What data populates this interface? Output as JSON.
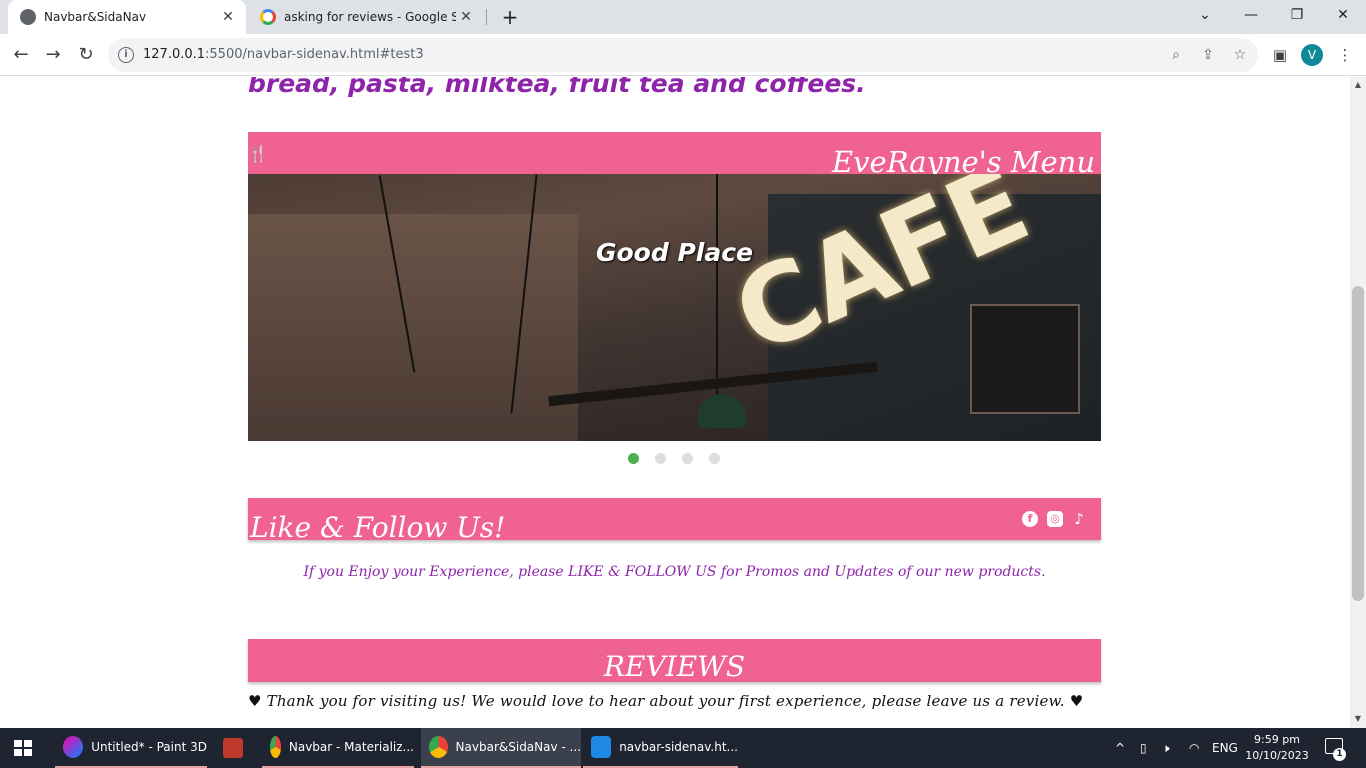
{
  "browser": {
    "tabs": [
      {
        "title": "Navbar&SidaNav",
        "active": true
      },
      {
        "title": "asking for reviews - Google Sear",
        "active": false
      }
    ],
    "new_tab_label": "+",
    "url_host": "127.0.0.1",
    "url_rest": ":5500/navbar-sidenav.html#test3",
    "profile_initial": "V"
  },
  "page": {
    "intro_text": "bread, pasta, milktea, fruit tea and coffees.",
    "menu": {
      "title": "EveRayne's Menu",
      "icon": "utensils-icon"
    },
    "carousel": {
      "caption": "Good Place",
      "sign_text": "CAFE",
      "slide_count": 4,
      "active_slide": 1
    },
    "follow": {
      "title": "Like & Follow Us!",
      "text": "If you Enjoy your Experience, please LIKE & FOLLOW US for Promos and Updates of our new products.",
      "social": [
        "facebook-icon",
        "instagram-icon",
        "tiktok-icon"
      ]
    },
    "reviews": {
      "title": "REVIEWS",
      "text": "♥ Thank you for visiting us! We would love to hear about your first experience, please leave us a review. ♥"
    }
  },
  "taskbar": {
    "items": [
      {
        "label": "Untitled* - Paint 3D"
      },
      {
        "label": ""
      },
      {
        "label": "Navbar - Materializ..."
      },
      {
        "label": "Navbar&SidaNav - ..."
      },
      {
        "label": "navbar-sidenav.ht..."
      }
    ],
    "language": "ENG",
    "time": "9:59 pm",
    "date": "10/10/2023",
    "notification_count": "1"
  },
  "colors": {
    "accent_pink": "#f06292",
    "purple_text": "#8e24aa",
    "active_dot": "#4caf50"
  }
}
